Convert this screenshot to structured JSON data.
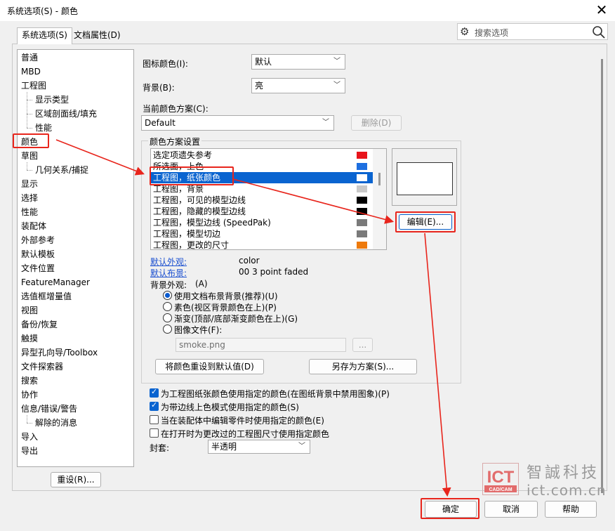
{
  "window": {
    "title": "系统选项(S) - 颜色",
    "close_glyph": "✕"
  },
  "tabs": [
    {
      "label": "系统选项(S)",
      "active": true
    },
    {
      "label": "文档属性(D)",
      "active": false
    }
  ],
  "search": {
    "placeholder": "搜索选项"
  },
  "nav": {
    "items": [
      {
        "label": "普通",
        "sub": false
      },
      {
        "label": "MBD",
        "sub": false
      },
      {
        "label": "工程图",
        "sub": false
      },
      {
        "label": "显示类型",
        "sub": true
      },
      {
        "label": "区域剖面线/填充",
        "sub": true
      },
      {
        "label": "性能",
        "sub": true
      },
      {
        "label": "颜色",
        "sub": false,
        "selected": true
      },
      {
        "label": "草图",
        "sub": false
      },
      {
        "label": "几何关系/捕捉",
        "sub": true
      },
      {
        "label": "显示",
        "sub": false
      },
      {
        "label": "选择",
        "sub": false
      },
      {
        "label": "性能",
        "sub": false
      },
      {
        "label": "装配体",
        "sub": false
      },
      {
        "label": "外部参考",
        "sub": false
      },
      {
        "label": "默认模板",
        "sub": false
      },
      {
        "label": "文件位置",
        "sub": false
      },
      {
        "label": "FeatureManager",
        "sub": false
      },
      {
        "label": "选值框增量值",
        "sub": false
      },
      {
        "label": "视图",
        "sub": false
      },
      {
        "label": "备份/恢复",
        "sub": false
      },
      {
        "label": "触摸",
        "sub": false
      },
      {
        "label": "异型孔向导/Toolbox",
        "sub": false
      },
      {
        "label": "文件探索器",
        "sub": false
      },
      {
        "label": "搜索",
        "sub": false
      },
      {
        "label": "协作",
        "sub": false
      },
      {
        "label": "信息/错误/警告",
        "sub": false
      },
      {
        "label": "解除的消息",
        "sub": true
      },
      {
        "label": "导入",
        "sub": false
      },
      {
        "label": "导出",
        "sub": false
      }
    ],
    "reset_button": "重设(R)..."
  },
  "options": {
    "icon_color_label": "图标颜色(I):",
    "icon_color_value": "默认",
    "background_label": "背景(B):",
    "background_value": "亮",
    "scheme_label": "当前颜色方案(C):",
    "scheme_value": "Default",
    "delete_button": "删除(D)",
    "scheme_settings_title": "颜色方案设置",
    "scheme_items": [
      {
        "label": "选定项遗失参考",
        "color": "#e8141b"
      },
      {
        "label": "所选面，上色",
        "color": "#1e6fe0"
      },
      {
        "label": "工程图，纸张颜色",
        "color": "#ffffff",
        "selected": true
      },
      {
        "label": "工程图，背景",
        "color": "#c9c9c9"
      },
      {
        "label": "工程图，可见的模型边线",
        "color": "#000000"
      },
      {
        "label": "工程图，隐藏的模型边线",
        "color": "#000000"
      },
      {
        "label": "工程图，模型边线 (SpeedPak)",
        "color": "#7a7a7a"
      },
      {
        "label": "工程图，模型切边",
        "color": "#7a7a7a"
      },
      {
        "label": "工程图，更改的尺寸",
        "color": "#ee7a0c"
      }
    ],
    "edit_button": "编辑(E)...",
    "default_appearance_label": "默认外观:",
    "default_appearance_value": "color",
    "default_scene_label": "默认布景:",
    "default_scene_value": "00 3 point faded",
    "bg_appearance_label": "背景外观:",
    "bg_appearance_hint": "(A)",
    "radios": [
      {
        "label": "使用文档布景背景(推荐)(U)",
        "checked": true
      },
      {
        "label": "素色(视区背景颜色在上)(P)",
        "checked": false
      },
      {
        "label": "渐变(顶部/底部渐变颜色在上)(G)",
        "checked": false
      },
      {
        "label": "图像文件(F):",
        "checked": false
      }
    ],
    "image_file": "smoke.png",
    "browse_button": "...",
    "reset_colors_button": "将颜色重设到默认值(D)",
    "save_scheme_button": "另存为方案(S)...",
    "checkboxes": [
      {
        "label": "为工程图纸张颜色使用指定的颜色(在图纸背景中禁用图象)(P)",
        "checked": true
      },
      {
        "label": "为带边线上色模式使用指定的颜色(S)",
        "checked": true
      },
      {
        "label": "当在装配体中编辑零件时使用指定的颜色(E)",
        "checked": false
      },
      {
        "label": "在打开时为更改过的工程图尺寸使用指定颜色",
        "checked": false
      }
    ],
    "envelope_label": "封套:",
    "envelope_value": "半透明"
  },
  "footer": {
    "ok": "确定",
    "cancel": "取消",
    "help": "帮助"
  },
  "watermark": {
    "logo_top": "ICT",
    "logo_bottom": "CAD/CAM",
    "name": "智誠科技",
    "url": "ict.com.cn"
  },
  "accent_colors": {
    "annotation_red": "#e8251c",
    "selection_blue": "#0a64d0"
  }
}
